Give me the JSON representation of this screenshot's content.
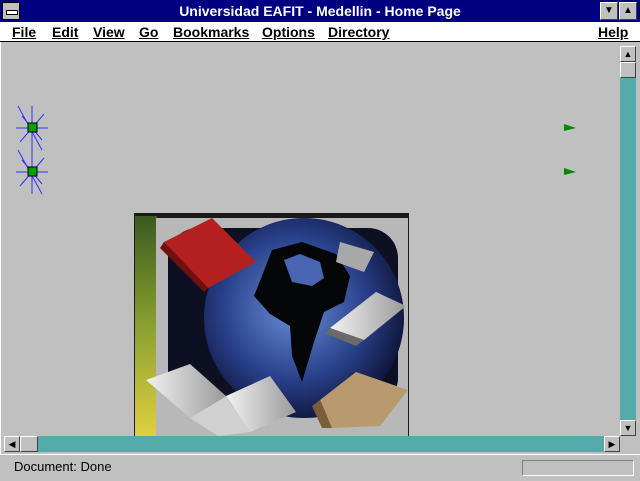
{
  "window": {
    "title": "Universidad EAFIT - Medellin - Home Page"
  },
  "menu": {
    "file": "File",
    "edit": "Edit",
    "view": "View",
    "go": "Go",
    "bookmarks": "Bookmarks",
    "options": "Options",
    "directory": "Directory",
    "help": "Help"
  },
  "status": {
    "text": "Document: Done"
  },
  "icons": {
    "system_menu": "system-menu-icon",
    "minimize": "minimize-icon",
    "maximize": "maximize-icon",
    "scroll_up": "arrow-up-icon",
    "scroll_down": "arrow-down-icon",
    "scroll_left": "arrow-left-icon",
    "scroll_right": "arrow-right-icon"
  },
  "colors": {
    "titlebar": "#000080",
    "scrollbar_track": "#55aaaa",
    "line_blue": "#4444ff",
    "line_green": "#008800"
  }
}
